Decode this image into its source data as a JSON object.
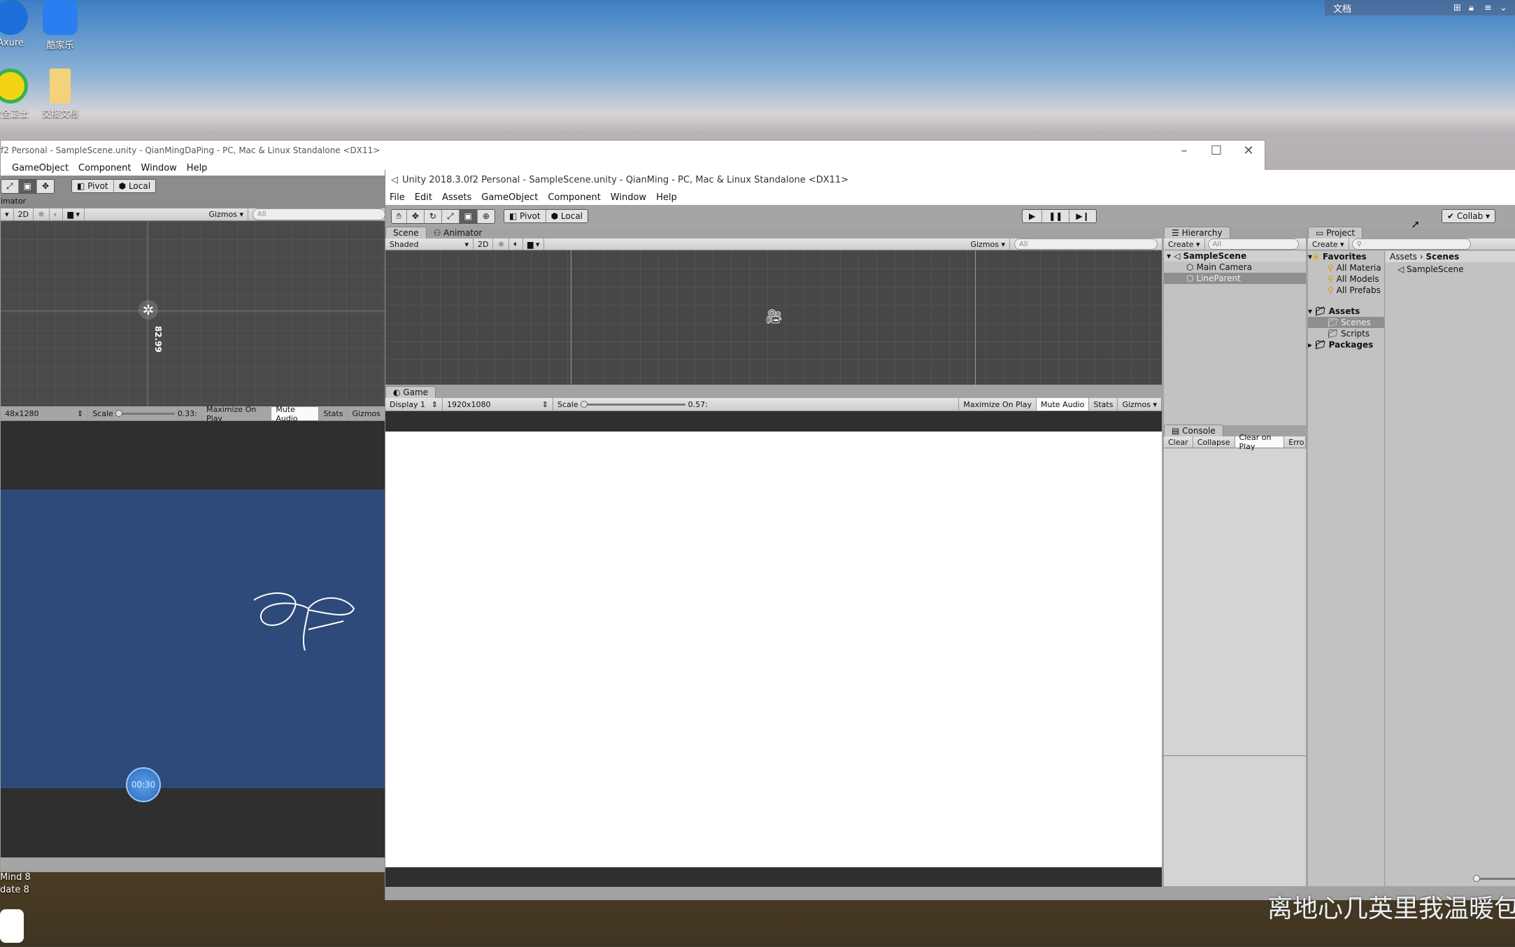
{
  "desktop": {
    "icons": [
      {
        "label": "Axure",
        "color": "#1e6fd9"
      },
      {
        "label": "酷家乐",
        "color": "#2a7ef0"
      },
      {
        "label": "安全卫士",
        "color": "#37b24d"
      },
      {
        "label": "交接文档",
        "color": "#f3d27a"
      }
    ],
    "bottom_icons": [
      {
        "label": "Mind 8"
      },
      {
        "label": "date 8"
      }
    ],
    "top_right": {
      "label": "文档",
      "icons": [
        "grid-icon",
        "lock-icon",
        "menu-icon",
        "chevron-down-icon"
      ]
    },
    "subtitle": "离地心几英里我温暖包"
  },
  "back_window": {
    "title": "f2 Personal - SampleScene.unity - QianMingDaPing - PC, Mac & Linux Standalone <DX11>",
    "menu": [
      "GameObject",
      "Component",
      "Window",
      "Help"
    ],
    "pivot": "Pivot",
    "local": "Local",
    "tab": "imator",
    "mode_2d": "2D",
    "gizmos": "Gizmos",
    "search": "All",
    "dimension_label": "82.99",
    "resolution": "48x1280",
    "scale_label": "Scale",
    "scale_value": "0.33:",
    "game_buttons": [
      "Maximize On Play",
      "Mute Audio",
      "Stats",
      "Gizmos"
    ],
    "timer": "00:30",
    "game_bg": "#2e4a7a"
  },
  "front_window": {
    "title": "Unity 2018.3.0f2 Personal - SampleScene.unity - QianMing - PC, Mac & Linux Standalone <DX11>",
    "menu": [
      "File",
      "Edit",
      "Assets",
      "GameObject",
      "Component",
      "Window",
      "Help"
    ],
    "pivot": "Pivot",
    "local": "Local",
    "collab": "Collab",
    "scene_tabs": [
      "Scene",
      "Animator"
    ],
    "shading": "Shaded",
    "mode_2d": "2D",
    "gizmos": "Gizmos",
    "search": "All",
    "game_tab": "Game",
    "display": "Display 1",
    "resolution": "1920x1080",
    "scale_label": "Scale",
    "scale_value": "0.57:",
    "scale_fraction": 0.0,
    "game_buttons": [
      "Maximize On Play",
      "Mute Audio",
      "Stats",
      "Gizmos"
    ],
    "hierarchy": {
      "tab": "Hierarchy",
      "create": "Create",
      "search": "All",
      "scene": "SampleScene",
      "items": [
        "Main Camera",
        "LineParent"
      ]
    },
    "console": {
      "tab": "Console",
      "buttons": [
        "Clear",
        "Collapse",
        "Clear on Play",
        "Erro"
      ]
    },
    "project": {
      "tab": "Project",
      "create": "Create",
      "favorites": "Favorites",
      "fav_items": [
        "All Materia",
        "All Models",
        "All Prefabs"
      ],
      "assets": "Assets",
      "asset_items": [
        "Scenes",
        "Scripts"
      ],
      "packages": "Packages",
      "breadcrumb": [
        "Assets",
        "Scenes"
      ],
      "files": [
        "SampleScene"
      ]
    }
  }
}
